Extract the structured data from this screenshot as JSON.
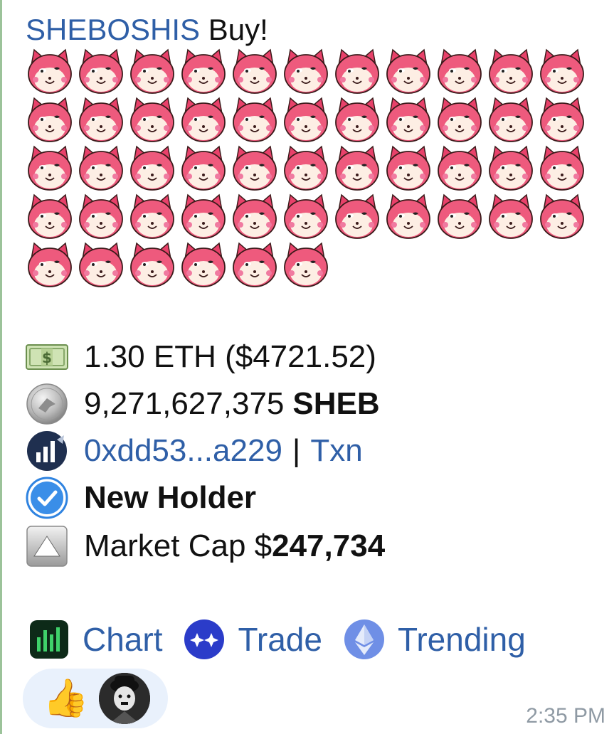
{
  "message": {
    "header": {
      "name": "SHEBOSHIS",
      "action": "Buy!"
    },
    "emoji_count": 50,
    "emoji_icon": "pink-cat-face-icon",
    "lines": {
      "eth": {
        "icon": "money-banknote-icon",
        "text": "1.30 ETH ($4721.52)"
      },
      "tokens": {
        "icon": "silver-coin-icon",
        "amount": "9,271,627,375",
        "symbol": "SHEB"
      },
      "wallet": {
        "icon": "chart-logo-icon",
        "address": "0xdd53...a229",
        "separator": "|",
        "txn": "Txn"
      },
      "holder": {
        "icon": "blue-check-icon",
        "text": "New Holder"
      },
      "market_cap": {
        "icon": "up-arrow-icon",
        "label": "Market Cap $",
        "value": "247,734"
      }
    },
    "links": [
      {
        "icon": "bar-chart-icon",
        "label": "Chart"
      },
      {
        "icon": "sparkle-icon",
        "label": "Trade"
      },
      {
        "icon": "ethereum-icon",
        "label": "Trending"
      }
    ],
    "reactions": {
      "emoji": "👍",
      "avatar": "avatar"
    },
    "time": "2:35 PM"
  },
  "colors": {
    "link": "#2f5fa7",
    "bubble": "#e9f1fc",
    "time": "#8f9aa4"
  }
}
